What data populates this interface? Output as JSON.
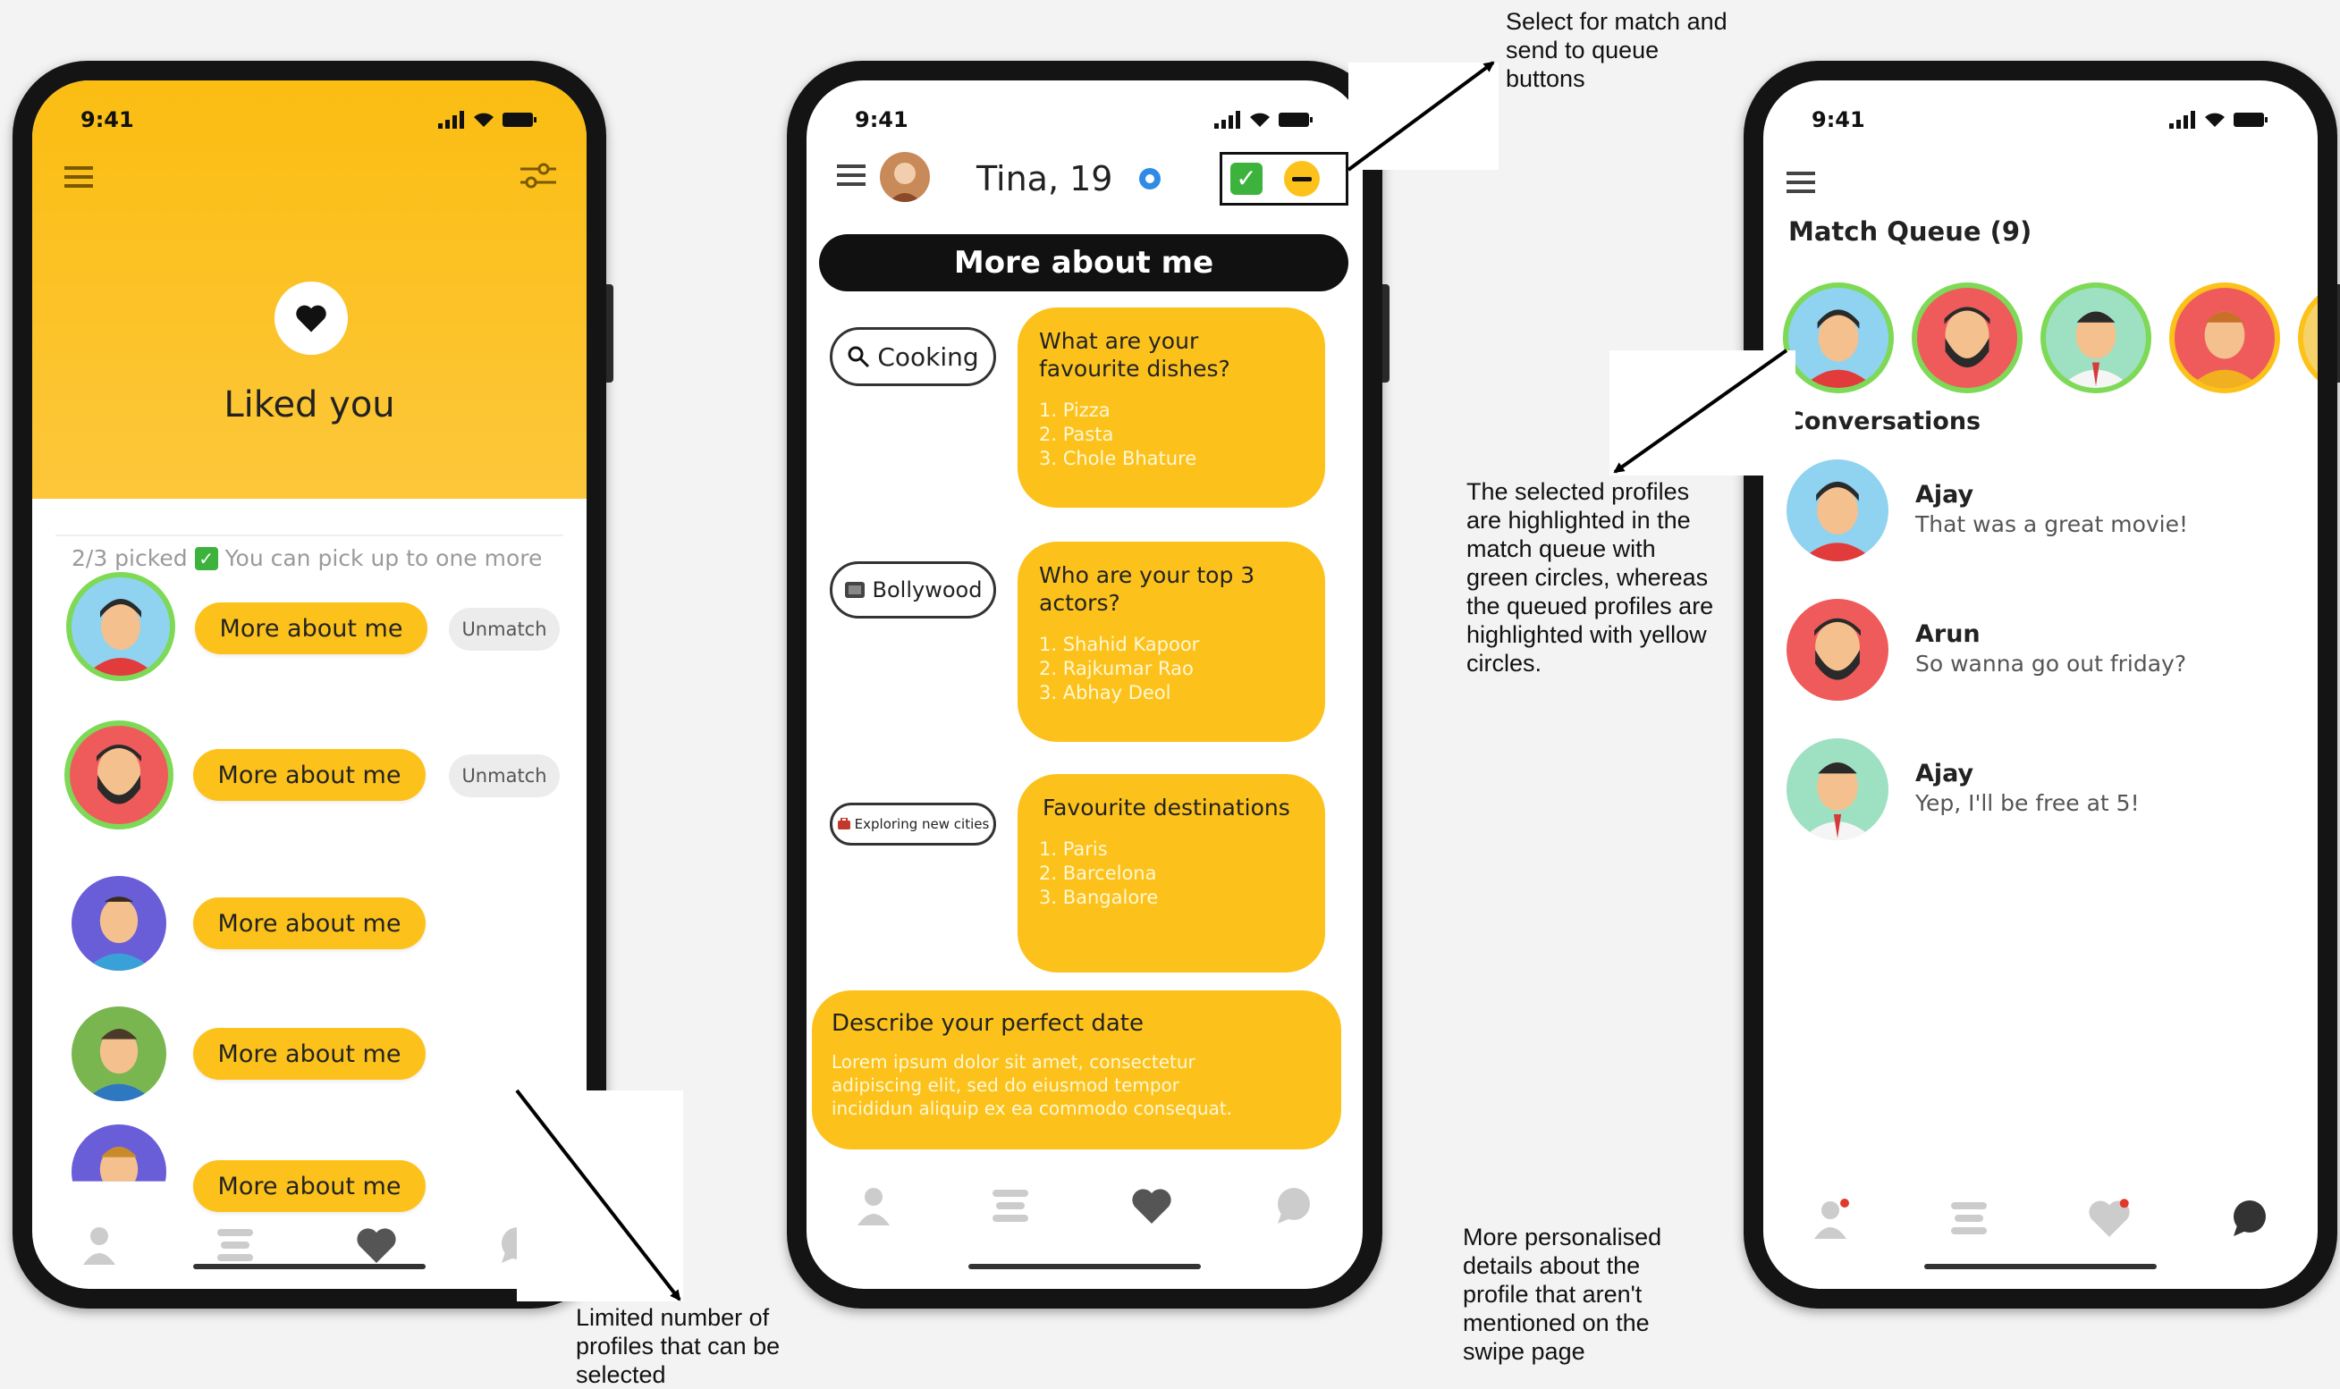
{
  "status_time": "9:41",
  "screen1": {
    "title": "Liked you",
    "picked": "2/3 picked",
    "pick_more": "You can pick up to one more",
    "more_label": "More about me",
    "unmatch_label": "Unmatch"
  },
  "screen2": {
    "name": "Tina, 19",
    "section_title": "More about me",
    "interests": [
      {
        "icon": "magnifier-icon",
        "label": "Cooking"
      },
      {
        "icon": "film-icon",
        "label": "Bollywood"
      },
      {
        "icon": "suitcase-icon",
        "label": "Exploring new cities"
      }
    ],
    "cards": [
      {
        "question": "What are your favourite dishes?",
        "answers": [
          "1. Pizza",
          "2. Pasta",
          "3. Chole Bhature"
        ]
      },
      {
        "question": "Who are your top 3 actors?",
        "answers": [
          "1. Shahid Kapoor",
          "2. Rajkumar Rao",
          "3. Abhay Deol"
        ]
      },
      {
        "question": "Favourite destinations",
        "answers": [
          "1. Paris",
          "2. Barcelona",
          "3. Bangalore"
        ]
      }
    ],
    "date_title": "Describe your perfect date",
    "date_text_1": "Lorem ipsum dolor sit amet, consectetur",
    "date_text_2": "adipiscing elit, sed do eiusmod tempor",
    "date_text_3": "incididun aliquip ex ea commodo consequat."
  },
  "screen3": {
    "queue_title": "Match Queue (9)",
    "conversations_title": "Conversations",
    "conversations": [
      {
        "name": "Ajay",
        "message": "That was a great movie!"
      },
      {
        "name": "Arun",
        "message": "So wanna go out friday?"
      },
      {
        "name": "Ajay",
        "message": "Yep, I'll be free at 5!"
      }
    ]
  },
  "annotations": {
    "select_buttons": [
      "Select for match and",
      "send to queue",
      "buttons"
    ],
    "highlighted": [
      "The selected profiles",
      "are highlighted in the",
      "match queue with",
      "green circles, whereas",
      "the queued profiles are",
      "highlighted  with yellow",
      "circles."
    ],
    "personalised": [
      "More personalised",
      "details about the",
      "profile that aren't",
      "mentioned on the",
      "swipe page"
    ],
    "limited": [
      "Limited number of",
      "profiles that can be",
      "selected"
    ]
  },
  "colors": {
    "accent": "#fcc21b",
    "selected_ring": "#7ed957",
    "dark": "#111111"
  }
}
